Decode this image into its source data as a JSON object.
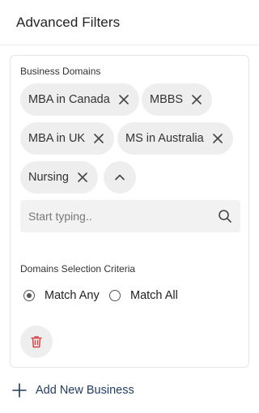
{
  "header": {
    "title": "Advanced Filters"
  },
  "domains": {
    "label": "Business Domains",
    "chips": [
      {
        "label": "MBA in Canada",
        "icon": "close-icon"
      },
      {
        "label": "MBBS",
        "icon": "close-icon"
      },
      {
        "label": "MBA in UK",
        "icon": "close-icon"
      },
      {
        "label": "MS in Australia",
        "icon": "close-icon"
      },
      {
        "label": "Nursing",
        "icon": "close-icon"
      }
    ],
    "collapse_icon": "chevron-up-icon",
    "search": {
      "placeholder": "Start typing..",
      "value": "",
      "icon": "search-icon"
    }
  },
  "criteria": {
    "label": "Domains Selection Criteria",
    "options": [
      {
        "label": "Match Any",
        "selected": true
      },
      {
        "label": "Match All",
        "selected": false
      }
    ]
  },
  "actions": {
    "delete_icon": "trash-icon",
    "delete_color": "#d64545",
    "add_label": "Add New Business",
    "add_color": "#1f3a5f"
  }
}
